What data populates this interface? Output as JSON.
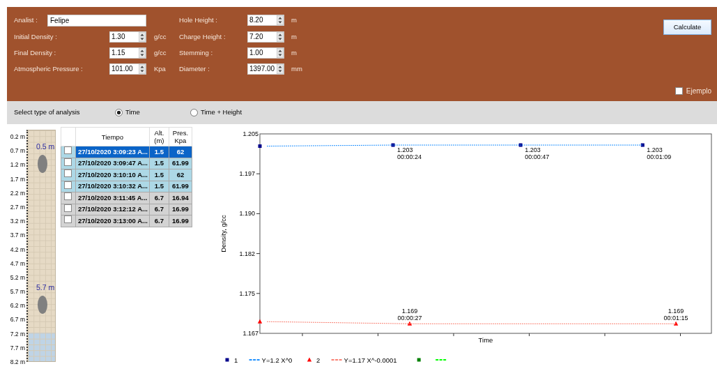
{
  "form": {
    "analist": {
      "label": "Analist :",
      "value": "Felipe"
    },
    "left_fields": [
      {
        "label": "Initial Density :",
        "value": "1.30",
        "unit": "g/cc"
      },
      {
        "label": "Final Density :",
        "value": "1.15",
        "unit": "g/cc"
      },
      {
        "label": "Atmospheric Pressure :",
        "value": "101.00",
        "unit": "Kpa"
      }
    ],
    "right_fields": [
      {
        "label": "Hole Height :",
        "value": "8.20",
        "unit": "m"
      },
      {
        "label": "Charge Height :",
        "value": "7.20",
        "unit": "m"
      },
      {
        "label": "Stemming :",
        "value": "1.00",
        "unit": "m"
      },
      {
        "label": "Diameter :",
        "value": "1397.00",
        "unit": "mm"
      }
    ],
    "calculate_button": "Calculate",
    "example_checkbox": {
      "label": "Ejemplo",
      "checked": false
    }
  },
  "analysis_type": {
    "label": "Select type of analysis",
    "options": [
      {
        "label": "Time",
        "selected": true
      },
      {
        "label": "Time + Height",
        "selected": false
      }
    ]
  },
  "ruler": {
    "ticks": [
      {
        "label": "0.2 m"
      },
      {
        "label": "0.7 m",
        "marker": "0.5 m"
      },
      {
        "label": "1.2 m"
      },
      {
        "label": "1.7 m"
      },
      {
        "label": "2.2 m"
      },
      {
        "label": "2.7 m"
      },
      {
        "label": "3.2 m"
      },
      {
        "label": "3.7 m"
      },
      {
        "label": "4.2 m"
      },
      {
        "label": "4.7 m"
      },
      {
        "label": "5.2 m"
      },
      {
        "label": "5.7 m",
        "marker": "5.7 m"
      },
      {
        "label": "6.2 m"
      },
      {
        "label": "6.7 m"
      },
      {
        "label": "7.2 m"
      },
      {
        "label": "7.7 m"
      },
      {
        "label": "8.2 m"
      }
    ],
    "water": {
      "level": 0.123
    }
  },
  "table": {
    "columns": [
      "Tiempo",
      "Alt. (m)",
      "Pres. Kpa"
    ],
    "rows": [
      {
        "checked": false,
        "selected": true,
        "color": "#add8e6",
        "cells": [
          "27/10/2020 3:09:23 A...",
          "1.5",
          "62"
        ]
      },
      {
        "checked": false,
        "selected": false,
        "color": "#add8e6",
        "cells": [
          "27/10/2020 3:09:47 A...",
          "1.5",
          "61.99"
        ]
      },
      {
        "checked": false,
        "selected": false,
        "color": "#add8e6",
        "cells": [
          "27/10/2020 3:10:10 A...",
          "1.5",
          "62"
        ]
      },
      {
        "checked": false,
        "selected": false,
        "color": "#add8e6",
        "cells": [
          "27/10/2020 3:10:32 A...",
          "1.5",
          "61.99"
        ]
      },
      {
        "checked": false,
        "selected": false,
        "color": "#d3d3d3",
        "cells": [
          "27/10/2020 3:11:45 A...",
          "6.7",
          "16.94"
        ]
      },
      {
        "checked": false,
        "selected": false,
        "color": "#d3d3d3",
        "cells": [
          "27/10/2020 3:12:12 A...",
          "6.7",
          "16.99"
        ]
      },
      {
        "checked": false,
        "selected": false,
        "color": "#d3d3d3",
        "cells": [
          "27/10/2020 3:13:00 A...",
          "6.7",
          "16.99"
        ]
      }
    ]
  },
  "chart": {
    "xlabel": "Time",
    "ylabel": "Density, g/cc",
    "yticks": [
      "1.205",
      "1.197",
      "1.190",
      "1.182",
      "1.175",
      "1.167"
    ],
    "legend": [
      {
        "label": "1",
        "kind": "square",
        "color": "#00008b"
      },
      {
        "label": "Y=1.2 X^0",
        "kind": "dashed",
        "color": "#1e90ff"
      },
      {
        "label": "2",
        "kind": "triangle",
        "color": "#ff0000"
      },
      {
        "label": "Y=1.17 X^-0.0001",
        "kind": "dashed",
        "color": "#fa8072"
      },
      {
        "kind": "square",
        "color": "#008000"
      },
      {
        "kind": "dashed",
        "color": "#00ff00"
      }
    ],
    "point_labels": [
      {
        "value": "1.203",
        "time": "00:00:24"
      },
      {
        "value": "1.203",
        "time": "00:00:47"
      },
      {
        "value": "1.203",
        "time": "00:01:09"
      },
      {
        "value": "1.169",
        "time": "00:00:27"
      },
      {
        "value": "1.169",
        "time": "00:01:15"
      }
    ]
  }
}
